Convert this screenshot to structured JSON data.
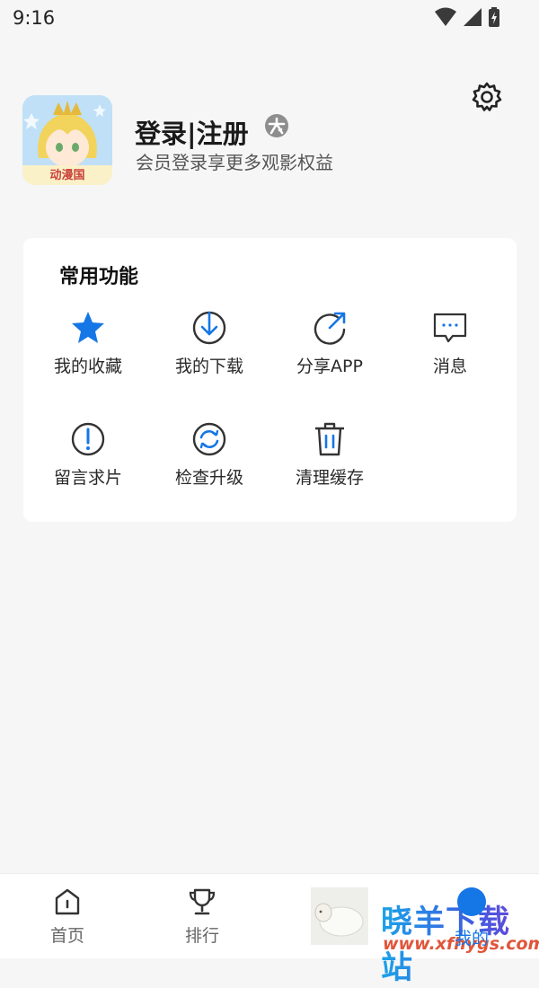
{
  "status_bar": {
    "time": "9:16"
  },
  "profile": {
    "avatar_caption": "动漫国",
    "title": "登录|注册",
    "subtitle": "会员登录享更多观影权益"
  },
  "functions": {
    "title": "常用功能",
    "items": [
      {
        "label": "我的收藏",
        "icon": "star-icon"
      },
      {
        "label": "我的下载",
        "icon": "download-icon"
      },
      {
        "label": "分享APP",
        "icon": "share-icon"
      },
      {
        "label": "消息",
        "icon": "message-icon"
      },
      {
        "label": "留言求片",
        "icon": "exclamation-icon"
      },
      {
        "label": "检查升级",
        "icon": "refresh-icon"
      },
      {
        "label": "清理缓存",
        "icon": "trash-icon"
      }
    ]
  },
  "bottom_nav": {
    "tabs": [
      {
        "label": "首页",
        "icon": "home-icon"
      },
      {
        "label": "排行",
        "icon": "trophy-icon"
      },
      {
        "label": "我的",
        "icon": "profile-icon",
        "active": true
      }
    ]
  },
  "watermark": {
    "text": "晓羊下载站",
    "url": "www.xfhygs.com"
  },
  "colors": {
    "accent": "#1576e6",
    "background": "#f6f6f6",
    "card": "#ffffff"
  }
}
